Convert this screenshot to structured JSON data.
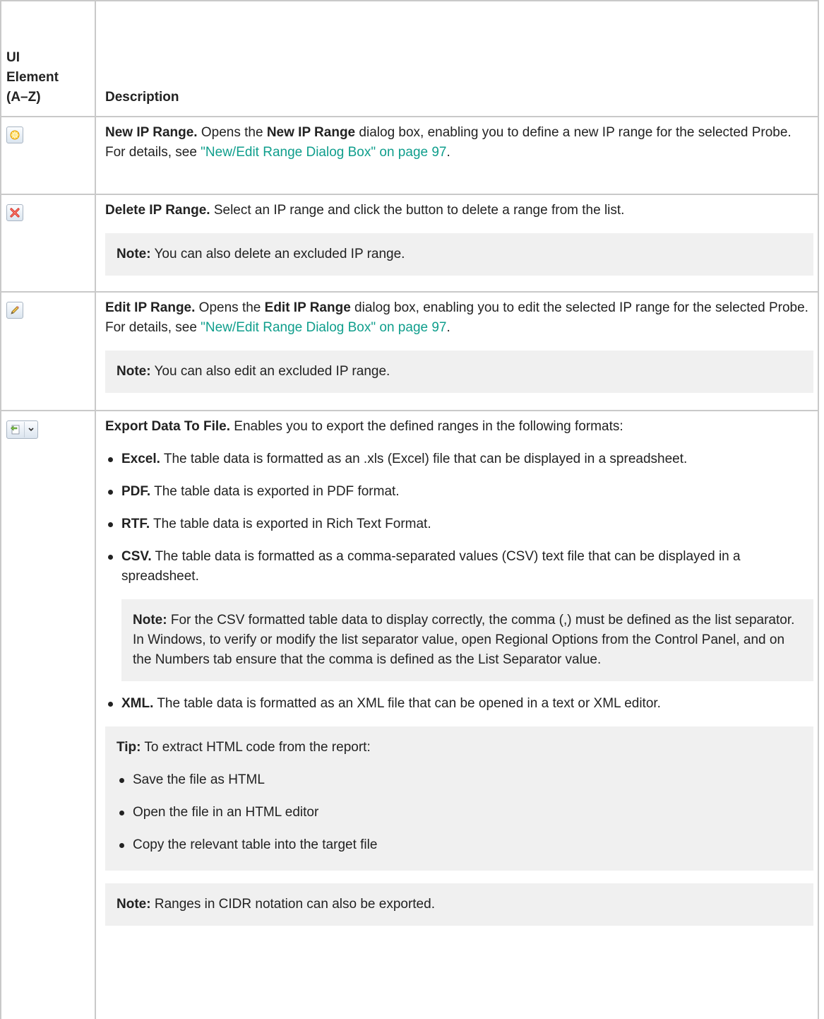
{
  "header": {
    "col1": "UI\nElement\n(A–Z)",
    "col2": "Description"
  },
  "rows": [
    {
      "icon": "new-star-icon",
      "title": "New IP Range.",
      "t1": " Opens the ",
      "b1": "New IP Range",
      "t2": " dialog box, enabling you to define a new IP range for the selected Probe. For details, see ",
      "link": "\"New/Edit Range Dialog Box\" on page 97",
      "t3": "."
    },
    {
      "icon": "delete-x-icon",
      "title": "Delete IP Range.",
      "t1": " Select an IP range and click the button to delete a range from the list.",
      "note_label": "Note:",
      "note_text": " You can also delete an excluded IP range."
    },
    {
      "icon": "pencil-edit-icon",
      "title": "Edit IP Range.",
      "t1": " Opens the ",
      "b1": "Edit IP Range",
      "t2": " dialog box, enabling you to edit the selected IP range for the selected Probe. For details, see ",
      "link": "\"New/Edit Range Dialog Box\" on page 97",
      "t3": ".",
      "note_label": "Note:",
      "note_text": " You can also edit an excluded IP range."
    },
    {
      "icon": "export-icon",
      "title": "Export Data To File.",
      "t1": " Enables you to export the defined ranges in the following formats:",
      "formats": [
        {
          "name": "Excel.",
          "text": " The table data is formatted as an .xls (Excel) file that can be displayed in a spreadsheet."
        },
        {
          "name": "PDF.",
          "text": " The table data is exported in PDF format."
        },
        {
          "name": "RTF.",
          "text": " The table data is exported in Rich Text Format."
        },
        {
          "name": "CSV.",
          "text": " The table data is formatted as a comma-separated values (CSV) text file that can be displayed in a spreadsheet."
        },
        {
          "name": "XML.",
          "text": " The table data is formatted as an XML file that can be opened in a text or XML editor."
        }
      ],
      "csv_note_label": "Note:",
      "csv_note_text": " For the CSV formatted table data to display correctly, the comma (,) must be defined as the list separator. In Windows, to verify or modify the list separator value, open Regional Options from the Control Panel, and on the Numbers tab ensure that the comma is defined as the List Separator value.",
      "tip_label": "Tip:",
      "tip_text": " To extract HTML code from the report:",
      "tip_steps": [
        "Save the file as HTML",
        "Open the file in an HTML editor",
        "Copy the relevant table into the target file"
      ],
      "cidr_note_label": "Note:",
      "cidr_note_text": " Ranges in CIDR notation can also be exported."
    }
  ],
  "colors": {
    "link": "#0f9e8c",
    "border": "#c9c9c9",
    "note_bg": "#f0f0f0"
  }
}
